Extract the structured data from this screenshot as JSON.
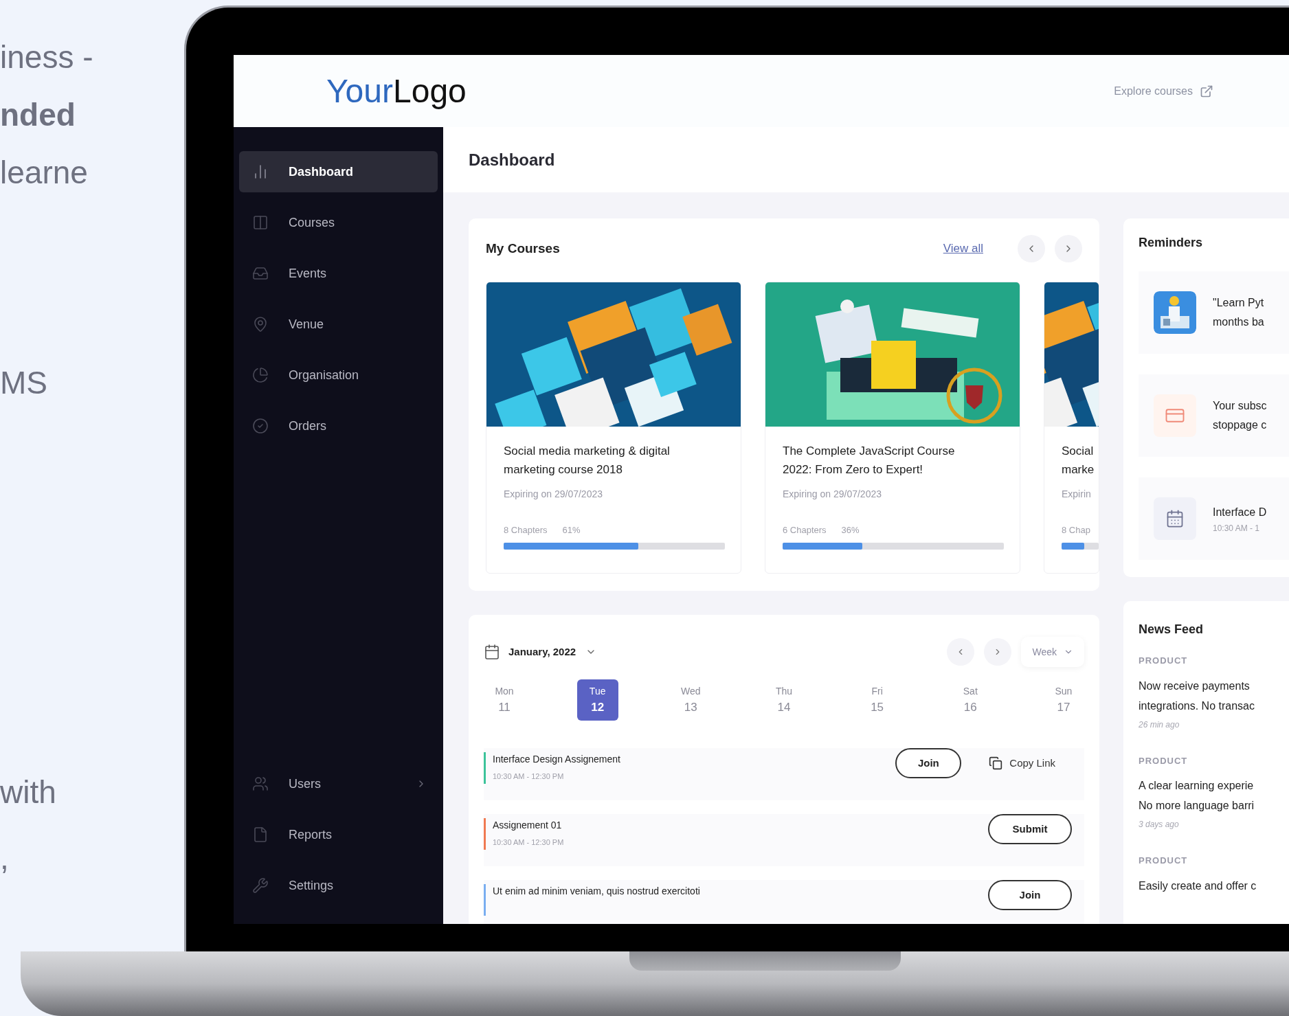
{
  "marketing_text": [
    {
      "text": "iness -",
      "bold": false
    },
    {
      "text": "nded",
      "bold": true
    },
    {
      "text": "learne",
      "bold": false
    },
    {
      "text": "MS",
      "bold": false
    },
    {
      "text": "with",
      "bold": false
    },
    {
      "text": ",",
      "bold": false
    }
  ],
  "header": {
    "logo_first": "Your",
    "logo_second": "Logo",
    "explore_link": "Explore courses"
  },
  "sidebar": {
    "items": [
      {
        "label": "Dashboard",
        "selected": true,
        "has_submenu": false
      },
      {
        "label": "Courses",
        "selected": false,
        "has_submenu": false
      },
      {
        "label": "Events",
        "selected": false,
        "has_submenu": false
      },
      {
        "label": "Venue",
        "selected": false,
        "has_submenu": false
      },
      {
        "label": "Organisation",
        "selected": false,
        "has_submenu": false
      },
      {
        "label": "Orders",
        "selected": false,
        "has_submenu": false
      }
    ],
    "bottom_items": [
      {
        "label": "Users",
        "selected": false,
        "has_submenu": true
      },
      {
        "label": "Reports",
        "selected": false,
        "has_submenu": false
      },
      {
        "label": "Settings",
        "selected": false,
        "has_submenu": false
      }
    ]
  },
  "page_title": "Dashboard",
  "my_courses": {
    "title": "My Courses",
    "view_all": "View all",
    "courses": [
      {
        "title_lines": [
          "Social media marketing & digital",
          "marketing course 2018"
        ],
        "expiry": "Expiring on 29/07/2023",
        "chapters": "8 Chapters",
        "percent": "61%",
        "level": 0.61
      },
      {
        "title_lines": [
          "The Complete JavaScript Course",
          "2022: From Zero to Expert!"
        ],
        "expiry": "Expiring on 29/07/2023",
        "chapters": "6 Chapters",
        "percent": "36%",
        "level": 0.36
      },
      {
        "title_lines": [
          "Social",
          "marke"
        ],
        "expiry": "Expirin",
        "chapters": "8 Chap",
        "level": 0.61
      }
    ]
  },
  "calendar": {
    "month": "January, 2022",
    "view": "Week",
    "days": [
      {
        "weekday": "Mon",
        "date": "11",
        "selected": false
      },
      {
        "weekday": "Tue",
        "date": "12",
        "selected": true
      },
      {
        "weekday": "Wed",
        "date": "13",
        "selected": false
      },
      {
        "weekday": "Thu",
        "date": "14",
        "selected": false
      },
      {
        "weekday": "Fri",
        "date": "15",
        "selected": false
      },
      {
        "weekday": "Sat",
        "date": "16",
        "selected": false
      },
      {
        "weekday": "Sun",
        "date": "17",
        "selected": false
      }
    ],
    "events": [
      {
        "title": "Interface Design Assignement",
        "time": "10:30 AM - 12:30 PM",
        "color": "#3cc39a",
        "actions": [
          {
            "label": "Join",
            "kind": "outline"
          },
          {
            "label": "Copy Link",
            "kind": "copy"
          }
        ]
      },
      {
        "title": "Assignement 01",
        "time": "10:30 AM - 12:30 PM",
        "color": "#f07a52",
        "actions": [
          {
            "label": "Submit",
            "kind": "outline"
          }
        ]
      },
      {
        "title": "Ut enim ad minim veniam, quis nostrud exercitoti",
        "color": "#7aaef0",
        "actions": [
          {
            "label": "Join",
            "kind": "outline"
          }
        ]
      }
    ]
  },
  "reminders": {
    "title": "Reminders",
    "items": [
      {
        "kind": "picture",
        "lines": [
          "\"Learn Pyt",
          "months ba"
        ]
      },
      {
        "kind": "card",
        "lines": [
          "Your subsc",
          "stoppage c"
        ]
      },
      {
        "kind": "calendar",
        "lines": [
          "Interface D"
        ],
        "time": "10:30 AM - 1"
      }
    ]
  },
  "news_feed": {
    "title": "News Feed",
    "items": [
      {
        "category": "PRODUCT",
        "lines": [
          "Now receive payments",
          "integrations. No transac"
        ],
        "time": "26 min ago"
      },
      {
        "category": "PRODUCT",
        "lines": [
          "A clear learning experie",
          "No more language barri"
        ],
        "time": "3 days ago"
      },
      {
        "category": "PRODUCT",
        "lines": [
          "Easily create and offer c"
        ]
      }
    ]
  }
}
